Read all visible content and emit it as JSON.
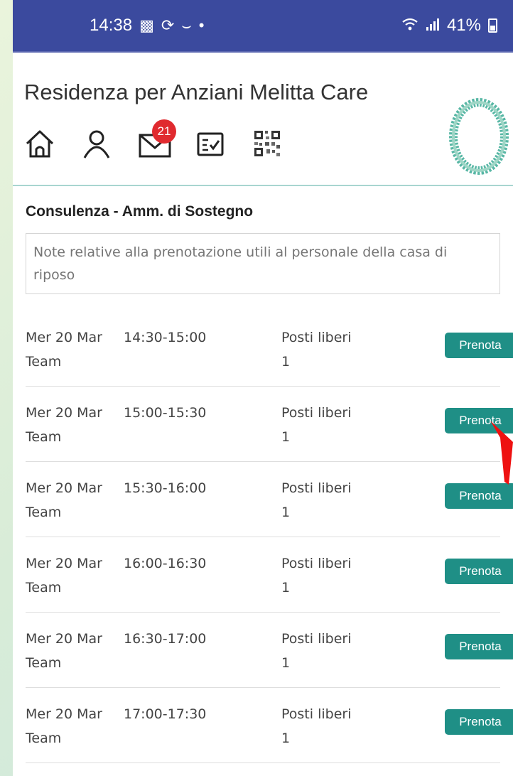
{
  "status_bar": {
    "time": "14:38",
    "left_icons": [
      "gallery-icon",
      "sync-icon",
      "ribbon-icon",
      "dot-icon"
    ],
    "battery": "41%",
    "right_icons": [
      "wifi-icon",
      "signal-icon",
      "battery-icon"
    ]
  },
  "header": {
    "title": "Residenza per Anziani Melitta Care",
    "messages_badge": "21"
  },
  "section": {
    "title": "Consulenza - Amm. di Sostegno",
    "notes_placeholder": "Note relative alla prenotazione utili al personale della casa di riposo"
  },
  "slots": [
    {
      "date": "Mer 20 Mar",
      "time": "14:30-15:00",
      "team": "Team",
      "posti_label": "Posti liberi",
      "posti": "1",
      "button": "Prenota"
    },
    {
      "date": "Mer 20 Mar",
      "time": "15:00-15:30",
      "team": "Team",
      "posti_label": "Posti liberi",
      "posti": "1",
      "button": "Prenota"
    },
    {
      "date": "Mer 20 Mar",
      "time": "15:30-16:00",
      "team": "Team",
      "posti_label": "Posti liberi",
      "posti": "1",
      "button": "Prenota"
    },
    {
      "date": "Mer 20 Mar",
      "time": "16:00-16:30",
      "team": "Team",
      "posti_label": "Posti liberi",
      "posti": "1",
      "button": "Prenota"
    },
    {
      "date": "Mer 20 Mar",
      "time": "16:30-17:00",
      "team": "Team",
      "posti_label": "Posti liberi",
      "posti": "1",
      "button": "Prenota"
    },
    {
      "date": "Mer 20 Mar",
      "time": "17:00-17:30",
      "team": "Team",
      "posti_label": "Posti liberi",
      "posti": "1",
      "button": "Prenota"
    }
  ],
  "colors": {
    "status_bar": "#3b4a9e",
    "button": "#1f8f86",
    "badge": "#e02a2f",
    "annotation_arrow": "#ee1111"
  }
}
